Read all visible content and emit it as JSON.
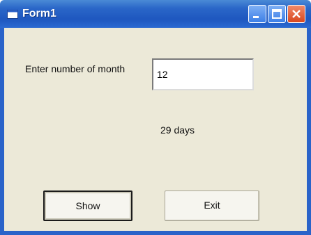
{
  "window": {
    "title": "Form1"
  },
  "titlebar_buttons": {
    "minimize_icon": "minimize-icon",
    "maximize_icon": "maximize-icon",
    "close_icon": "close-icon"
  },
  "form": {
    "prompt_label": "Enter number of month",
    "month_input_value": "12",
    "result_label": "29 days"
  },
  "buttons": {
    "show_label": "Show",
    "exit_label": "Exit"
  },
  "colors": {
    "titlebar": "#2a66c8",
    "client_background": "#ece9d8",
    "close_button": "#d9471e"
  }
}
